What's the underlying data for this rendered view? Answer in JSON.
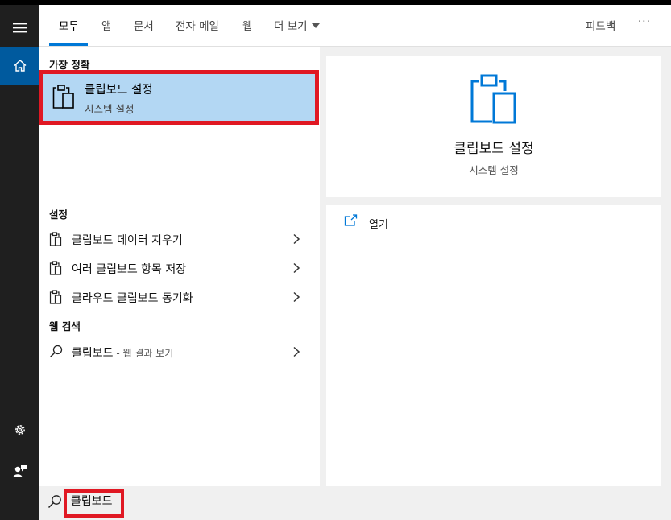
{
  "tabs": {
    "all": "모두",
    "apps": "앱",
    "documents": "문서",
    "email": "전자 메일",
    "web": "웹",
    "more": "더 보기",
    "feedback": "피드백",
    "ellipsis": "···"
  },
  "best_match": {
    "header": "가장 정확",
    "title": "클립보드 설정",
    "subtitle": "시스템 설정",
    "icon": "clipboard-icon"
  },
  "settings": {
    "header": "설정",
    "items": [
      {
        "label": "클립보드 데이터 지우기",
        "icon": "clipboard-icon"
      },
      {
        "label": "여러 클립보드 항목 저장",
        "icon": "clipboard-icon"
      },
      {
        "label": "클라우드 클립보드 동기화",
        "icon": "clipboard-icon"
      }
    ]
  },
  "web_search": {
    "header": "웹 검색",
    "query": "클립보드",
    "suffix": " - 웹 결과 보기",
    "icon": "search-icon"
  },
  "preview": {
    "title": "클립보드 설정",
    "subtitle": "시스템 설정",
    "open_label": "열기"
  },
  "search": {
    "value": "클립보드"
  },
  "colors": {
    "accent": "#0078d7",
    "selection": "#b3d7f3",
    "highlight_box": "#e01823",
    "rail": "#1f1f1f",
    "rail_active": "#005a9e"
  }
}
